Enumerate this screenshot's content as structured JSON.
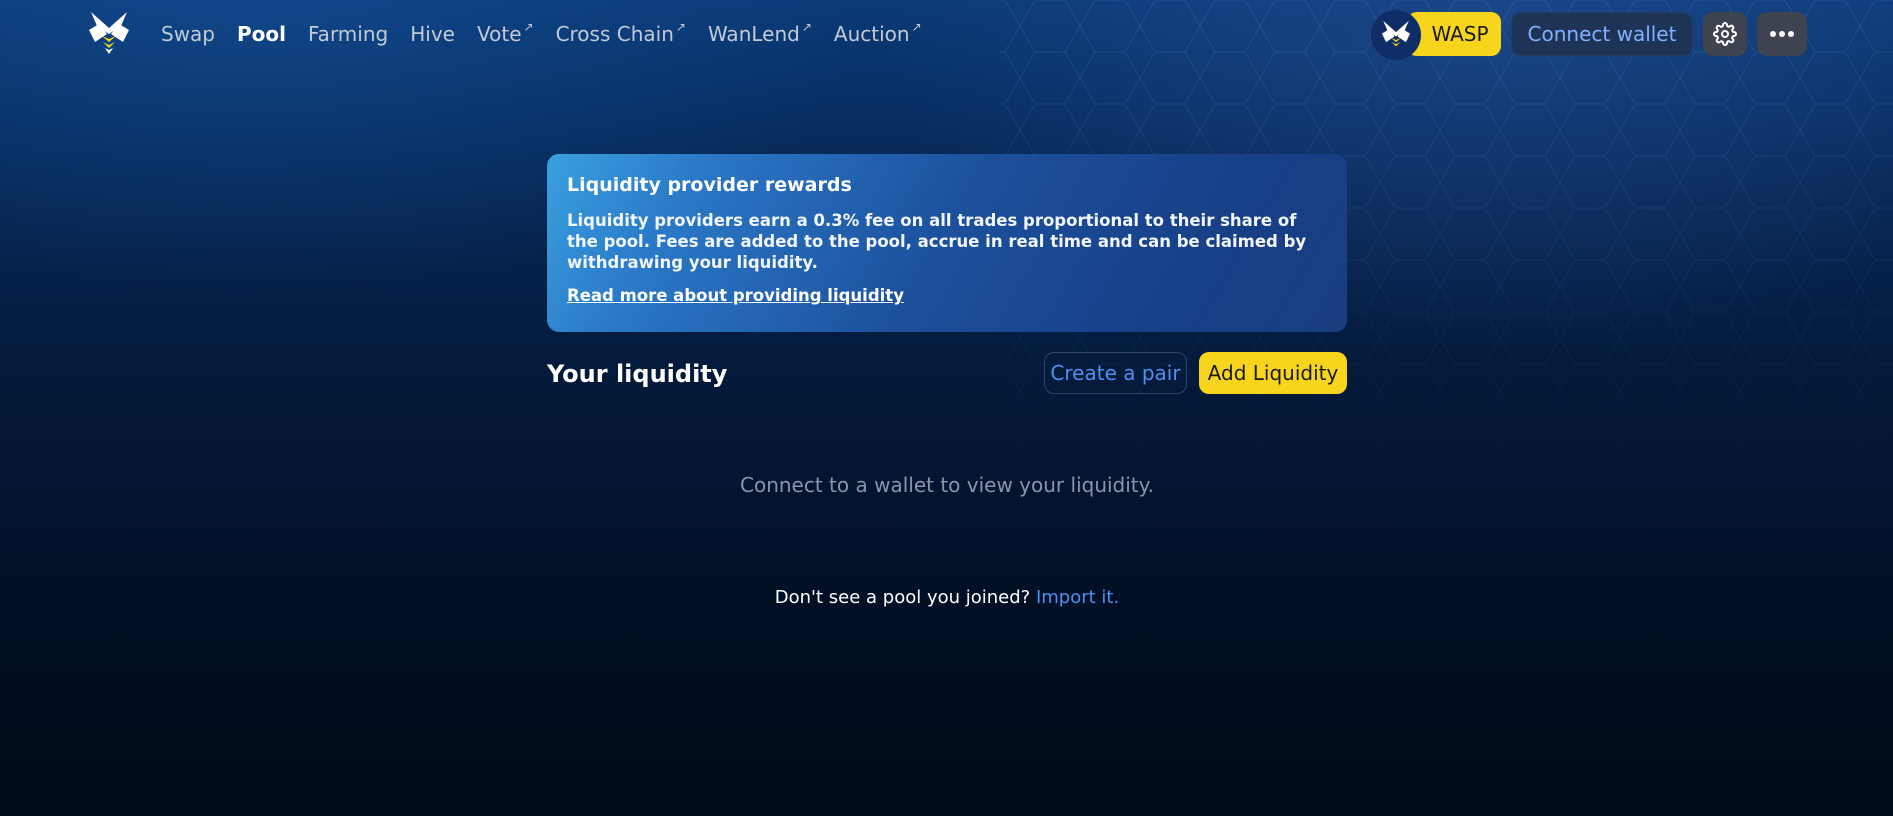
{
  "header": {
    "nav": [
      {
        "label": "Swap",
        "external": false,
        "active": false
      },
      {
        "label": "Pool",
        "external": false,
        "active": true
      },
      {
        "label": "Farming",
        "external": false,
        "active": false
      },
      {
        "label": "Hive",
        "external": false,
        "active": false
      },
      {
        "label": "Vote",
        "external": true,
        "active": false
      },
      {
        "label": "Cross Chain",
        "external": true,
        "active": false
      },
      {
        "label": "WanLend",
        "external": true,
        "active": false
      },
      {
        "label": "Auction",
        "external": true,
        "active": false
      }
    ],
    "external_arrow": "↗",
    "token_label": "WASP",
    "connect_wallet_label": "Connect wallet",
    "settings_icon": "gear-icon",
    "more_icon": "more-dots-icon"
  },
  "rewards": {
    "title": "Liquidity provider rewards",
    "text": "Liquidity providers earn a 0.3% fee on all trades proportional to their share of the pool. Fees are added to the pool, accrue in real time and can be claimed by withdrawing your liquidity.",
    "link": "Read more about providing liquidity"
  },
  "liquidity": {
    "title": "Your liquidity",
    "create_pair_label": "Create a pair",
    "add_liquidity_label": "Add Liquidity",
    "empty_message": "Connect to a wallet to view your liquidity.",
    "import_prompt": "Don't see a pool you joined?",
    "import_link": "Import it."
  },
  "colors": {
    "accent_yellow": "#f7d51c",
    "link_blue": "#4f8ff0",
    "connect_text": "#7fb1ff",
    "background_top": "#0a3a78",
    "background_bottom": "#010a18"
  }
}
